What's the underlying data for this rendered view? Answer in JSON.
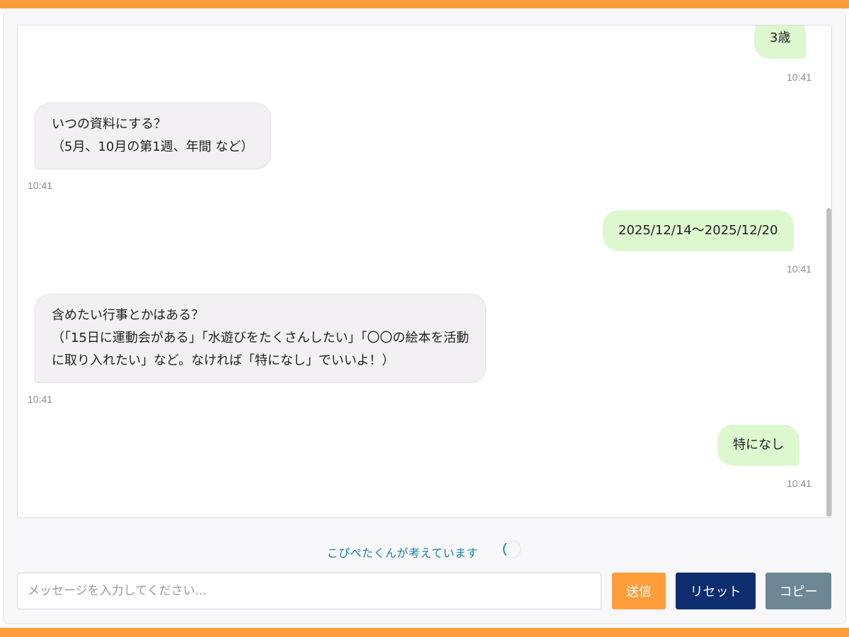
{
  "colors": {
    "accent": "#fd9e3b",
    "user_bubble": "#ddf7cf",
    "bot_bubble": "#f2f0f3",
    "status_text": "#1a7fb0",
    "send_button": "#fd9e3b",
    "reset_button": "#0d2d6e",
    "copy_button": "#6e8794"
  },
  "messages": [
    {
      "role": "user",
      "text": "3歳",
      "time": "10:41"
    },
    {
      "role": "bot",
      "lines": [
        "いつの資料にする？",
        "（5月、10月の第1週、年間 など）"
      ],
      "time": "10:41"
    },
    {
      "role": "user",
      "text": "2025/12/14〜2025/12/20",
      "time": "10:41"
    },
    {
      "role": "bot",
      "lines": [
        "含めたい行事とかはある？",
        "（｢15日に運動会がある｣「水遊びをたくさんしたい」「〇〇の絵本を活動",
        "に取り入れたい」など。なければ「特になし」でいいよ！）"
      ],
      "time": "10:41"
    },
    {
      "role": "user",
      "text": "特になし",
      "time": "10:41"
    }
  ],
  "status": {
    "thinking": "こぴぺたくんが考えています"
  },
  "composer": {
    "placeholder": "メッセージを入力してください...",
    "value": "",
    "send_label": "送信",
    "reset_label": "リセット",
    "copy_label": "コピー"
  }
}
